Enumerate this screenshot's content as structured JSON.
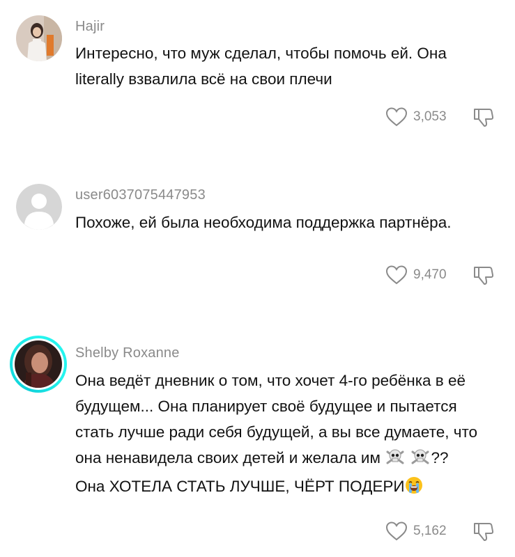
{
  "comments": [
    {
      "username": "Hajir",
      "lines": [
        "Интересно, что муж сделал, чтобы помочь ей. Она",
        "literally взвалила всё на свои плечи"
      ],
      "likes": "3,053",
      "avatar_icon": "user-photo-avatar",
      "like_icon": "heart-outline-icon",
      "dislike_icon": "thumbs-down-outline-icon"
    },
    {
      "username": "user6037075447953",
      "lines": [
        "Похоже, ей была необходима поддержка партнёра."
      ],
      "likes": "9,470",
      "avatar_icon": "default-user-avatar",
      "like_icon": "heart-outline-icon",
      "dislike_icon": "thumbs-down-outline-icon"
    },
    {
      "username": "Shelby Roxanne",
      "lines": [
        "Она ведёт дневник о том, что хочет 4-го ребёнка в её",
        "будущем... Она планирует своё будущее и пытается",
        "стать лучше ради себя будущей, а вы все думаете, что",
        "она ненавидела своих детей и желала им",
        "Она ХОТЕЛА СТАТЬ ЛУЧШЕ, ЧЁРТ ПОДЕРИ"
      ],
      "line4_suffix": "??",
      "likes": "5,162",
      "avatar_icon": "story-ring-photo-avatar",
      "like_icon": "heart-outline-icon",
      "dislike_icon": "thumbs-down-outline-icon",
      "inline_emoji": [
        "skull-crossbones-emoji",
        "skull-crossbones-emoji",
        "loudly-crying-face-emoji"
      ]
    }
  ],
  "colors": {
    "username": "#8a8a8a",
    "text": "#121212",
    "icon": "#8a8a8a",
    "story_ring": "#25f4ee"
  }
}
